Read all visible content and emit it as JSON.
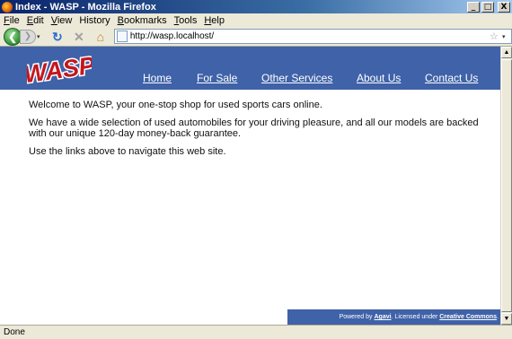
{
  "window": {
    "title": "Index - WASP - Mozilla Firefox",
    "minimize": "_",
    "maximize": "□",
    "close": "X"
  },
  "menu": {
    "items": [
      {
        "key": "F",
        "rest": "ile"
      },
      {
        "key": "E",
        "rest": "dit"
      },
      {
        "key": "V",
        "rest": "iew"
      },
      {
        "key": "H",
        "rest": "istory",
        "underline_pos": 1
      },
      {
        "key": "B",
        "rest": "ookmarks"
      },
      {
        "key": "T",
        "rest": "ools"
      },
      {
        "key": "H",
        "rest": "elp"
      }
    ]
  },
  "toolbar": {
    "back": "❮",
    "forward": "❯",
    "reload": "↻",
    "stop": "✕",
    "home": "⌂",
    "url": "http://wasp.localhost/",
    "star": "☆",
    "dropdown": "▾"
  },
  "site": {
    "logo_text": "WASP",
    "nav": [
      {
        "label": "Home"
      },
      {
        "label": "For Sale"
      },
      {
        "label": "Other Services"
      },
      {
        "label": "About Us"
      },
      {
        "label": "Contact Us"
      }
    ],
    "paragraphs": [
      "Welcome to WASP, your one-stop shop for used sports cars online.",
      "We have a wide selection of used automobiles for your driving pleasure, and all our models are backed with our unique 120-day money-back guarantee.",
      "Use the links above to navigate this web site."
    ],
    "footer": {
      "prefix": "Powered by ",
      "link1": "Agavi",
      "middle": ". Licensed under ",
      "link2": "Creative Commons",
      "suffix": "."
    }
  },
  "status": {
    "text": "Done"
  },
  "colors": {
    "header_blue": "#3f62a8",
    "logo_red": "#c4161c"
  }
}
